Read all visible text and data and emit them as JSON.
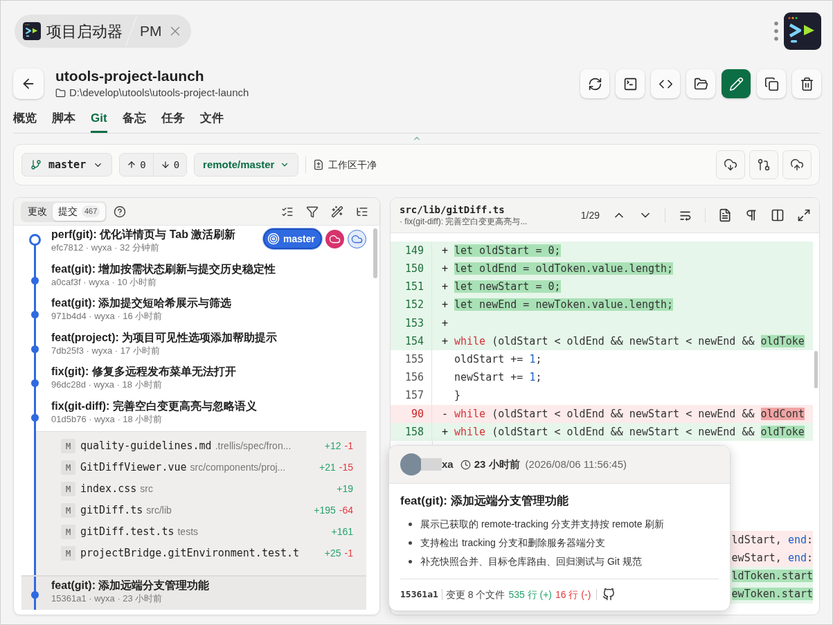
{
  "app_tab": {
    "title": "项目启动器",
    "subtitle": "PM"
  },
  "project": {
    "name": "utools-project-launch",
    "path": "D:\\develop\\utools\\utools-project-launch"
  },
  "actions": [
    {
      "kind": "refresh",
      "primary": false
    },
    {
      "kind": "terminal",
      "primary": false
    },
    {
      "kind": "code",
      "primary": false
    },
    {
      "kind": "folder",
      "primary": false
    },
    {
      "kind": "edit",
      "primary": true
    },
    {
      "kind": "copy",
      "primary": false
    },
    {
      "kind": "delete",
      "primary": false
    }
  ],
  "tabs": [
    {
      "label": "概览",
      "selected": false
    },
    {
      "label": "脚本",
      "selected": false
    },
    {
      "label": "Git",
      "selected": true
    },
    {
      "label": "备忘",
      "selected": false
    },
    {
      "label": "任务",
      "selected": false
    },
    {
      "label": "文件",
      "selected": false
    }
  ],
  "branch": {
    "name": "master",
    "ahead": "0",
    "behind": "0",
    "remote": "remote/master",
    "status": "工作区干净"
  },
  "sync_buttons": [
    {
      "kind": "pull"
    },
    {
      "kind": "compare"
    },
    {
      "kind": "push"
    }
  ],
  "left_tabs": [
    {
      "label": "更改",
      "selected": false
    },
    {
      "label": "提交",
      "count": "467",
      "selected": true
    }
  ],
  "commits": [
    {
      "title": "perf(git): 优化详情页与 Tab 激活刷新",
      "meta": "efc7812 · wyxa · 32 分钟前",
      "head": true,
      "highlighted": false,
      "refs": [
        {
          "kind": "branch",
          "label": "master"
        },
        {
          "kind": "remote",
          "color": "#d6336c"
        },
        {
          "kind": "remote-outline",
          "color": "#3b6fd8"
        }
      ]
    },
    {
      "title": "feat(git): 增加按需状态刷新与提交历史稳定性",
      "meta": "a0caf3f · wyxa · 10 小时前",
      "head": false,
      "highlighted": false
    },
    {
      "title": "feat(git): 添加提交短哈希展示与筛选",
      "meta": "971b4d4 · wyxa · 16 小时前",
      "head": false,
      "highlighted": false
    },
    {
      "title": "feat(project): 为项目可见性选项添加帮助提示",
      "meta": "7db25f3 · wyxa · 17 小时前",
      "head": false,
      "highlighted": false
    },
    {
      "title": "fix(git): 修复多远程发布菜单无法打开",
      "meta": "96dc28d · wyxa · 18 小时前",
      "head": false,
      "highlighted": false
    },
    {
      "title": "fix(git-diff): 完善空白变更高亮与忽略语义",
      "meta": "01d5b76 · wyxa · 18 小时前",
      "head": false,
      "highlighted": false,
      "files": [
        {
          "status": "M",
          "name": "quality-guidelines.md",
          "dir": ".trellis/spec/fron...",
          "added": "+12",
          "removed": "-1"
        },
        {
          "status": "M",
          "name": "GitDiffViewer.vue",
          "dir": "src/components/proj...",
          "added": "+21",
          "removed": "-15"
        },
        {
          "status": "M",
          "name": "index.css",
          "dir": "src",
          "added": "+19"
        },
        {
          "status": "M",
          "name": "gitDiff.ts",
          "dir": "src/lib",
          "added": "+195",
          "removed": "-64"
        },
        {
          "status": "M",
          "name": "gitDiff.test.ts",
          "dir": "tests",
          "added": "+161"
        },
        {
          "status": "M",
          "name": "projectBridge.gitEnvironment.test.t",
          "added": "+25",
          "removed": "-1"
        }
      ]
    },
    {
      "title": "feat(git): 添加远端分支管理功能",
      "meta": "15361a1 · wyxa · 23 小时前",
      "head": false,
      "highlighted": true
    }
  ],
  "diff": {
    "file": "src/lib/gitDiff.ts",
    "commit": "· fix(git-diff): 完善空白变更高亮与...",
    "position": "1/29",
    "lines": [
      {
        "number": "149",
        "kind": "add",
        "sign": "+",
        "code": [
          {
            "text": "  let oldStart = 0;",
            "kind": "changed"
          }
        ]
      },
      {
        "number": "150",
        "kind": "add",
        "sign": "+",
        "code": [
          {
            "text": "  let oldEnd = oldToken.value.length;",
            "kind": "changed"
          }
        ]
      },
      {
        "number": "151",
        "kind": "add",
        "sign": "+",
        "code": [
          {
            "text": "  let newStart = 0;",
            "kind": "changed"
          }
        ]
      },
      {
        "number": "152",
        "kind": "add",
        "sign": "+",
        "code": [
          {
            "text": "  let newEnd = newToken.value.length;",
            "kind": "changed"
          }
        ]
      },
      {
        "number": "153",
        "kind": "add",
        "sign": "+"
      },
      {
        "number": "154",
        "kind": "add",
        "sign": "+",
        "code": [
          {
            "text": "  while",
            "kind": "keyword"
          },
          {
            "text": " (oldStart < oldEnd && newStart < newEnd && ",
            "kind": "text"
          },
          {
            "text": "oldToke",
            "kind": "changed"
          }
        ]
      },
      {
        "number": "155",
        "kind": "ctx",
        "code": [
          {
            "text": "    oldStart += ",
            "kind": "text"
          },
          {
            "text": "1",
            "kind": "number"
          },
          {
            "text": ";",
            "kind": "text"
          }
        ]
      },
      {
        "number": "156",
        "kind": "ctx",
        "code": [
          {
            "text": "    newStart += ",
            "kind": "text"
          },
          {
            "text": "1",
            "kind": "number"
          },
          {
            "text": ";",
            "kind": "text"
          }
        ]
      },
      {
        "number": "157",
        "kind": "ctx",
        "code": [
          {
            "text": "  }",
            "kind": "text"
          }
        ]
      },
      {
        "number": "90",
        "kind": "del",
        "sign": "-",
        "code": [
          {
            "text": "  while",
            "kind": "keyword"
          },
          {
            "text": " (oldStart < oldEnd && newStart < newEnd && ",
            "kind": "text"
          },
          {
            "text": "oldCont",
            "kind": "changed"
          }
        ]
      },
      {
        "number": "158",
        "kind": "add",
        "sign": "+",
        "code": [
          {
            "text": "  while",
            "kind": "keyword"
          },
          {
            "text": " (oldStart < oldEnd && newStart < newEnd && ",
            "kind": "text"
          },
          {
            "text": "oldToke",
            "kind": "changed"
          }
        ]
      }
    ],
    "covered_lines": [
      {
        "kind": "del",
        "code": [
          {
            "text": "ldStart, ",
            "kind": "text"
          },
          {
            "text": "end",
            "kind": "number"
          },
          {
            "text": ":",
            "kind": "text"
          }
        ]
      },
      {
        "kind": "del",
        "code": [
          {
            "text": "ewStart, ",
            "kind": "text"
          },
          {
            "text": "end",
            "kind": "number"
          },
          {
            "text": ":",
            "kind": "text"
          }
        ]
      },
      {
        "kind": "add",
        "code": [
          {
            "text": "ldToken.start",
            "kind": "changed"
          }
        ]
      },
      {
        "kind": "add",
        "code": [
          {
            "text": "ewToken.start",
            "kind": "changed"
          }
        ]
      }
    ]
  },
  "tooltip": {
    "author": "xa",
    "time": "23 小时前",
    "date": "(2026/08/06 11:56:45)",
    "title": "feat(git): 添加远端分支管理功能",
    "bullets": [
      "展示已获取的 remote-tracking 分支并支持按 remote 刷新",
      "支持检出 tracking 分支和删除服务器端分支",
      "补充快照合并、目标仓库路由、回归测试与 Git 规范"
    ],
    "hash": "15361a1",
    "files": "变更 8 个文件",
    "added": "535 行 (+)",
    "removed": "16 行 (-)"
  }
}
